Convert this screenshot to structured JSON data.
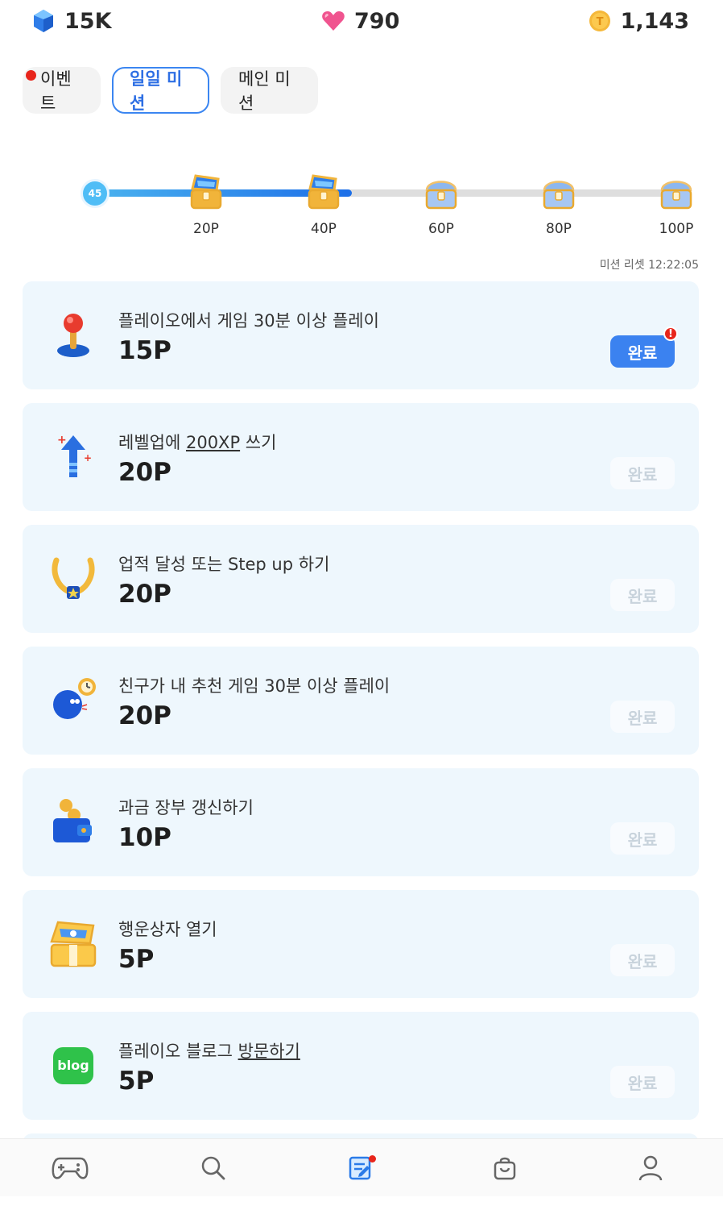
{
  "currency": {
    "gems": "15K",
    "hearts": "790",
    "coins": "1,143",
    "gem_icon": "blue-gem-icon",
    "heart_icon": "pink-heart-icon",
    "coin_icon": "gold-coin-icon"
  },
  "tabs": [
    {
      "label": "이벤트",
      "active": false,
      "has_dot": true
    },
    {
      "label": "일일 미션",
      "active": true,
      "has_dot": false
    },
    {
      "label": "메인 미션",
      "active": false,
      "has_dot": false
    }
  ],
  "progress": {
    "current": "45",
    "current_points": 45,
    "max_points": 100,
    "milestones": [
      {
        "label": "20P",
        "points": 20,
        "opened": true
      },
      {
        "label": "40P",
        "points": 40,
        "opened": true
      },
      {
        "label": "60P",
        "points": 60,
        "opened": false
      },
      {
        "label": "80P",
        "points": 80,
        "opened": false
      },
      {
        "label": "100P",
        "points": 100,
        "opened": false
      }
    ]
  },
  "reset_text": "미션 리셋 12:22:05",
  "missions": [
    {
      "title": "플레이오에서 게임 30분 이상 플레이",
      "points": "15P",
      "button": "완료",
      "enabled": true,
      "alert": "!",
      "icon": "joystick-icon"
    },
    {
      "title_pre": "레벨업에 ",
      "title_link": "200XP",
      "title_post": " 쓰기",
      "points": "20P",
      "button": "완료",
      "enabled": false,
      "icon": "level-up-arrow-icon"
    },
    {
      "title": "업적 달성 또는 Step up 하기",
      "points": "20P",
      "button": "완료",
      "enabled": false,
      "icon": "laurel-medal-icon"
    },
    {
      "title": "친구가 내 추천 게임 30분 이상 플레이",
      "points": "20P",
      "button": "완료",
      "enabled": false,
      "icon": "friend-clock-icon"
    },
    {
      "title": "과금 장부 갱신하기",
      "points": "10P",
      "button": "완료",
      "enabled": false,
      "icon": "wallet-coin-icon"
    },
    {
      "title": "행운상자 열기",
      "points": "5P",
      "button": "완료",
      "enabled": false,
      "icon": "lucky-box-icon"
    },
    {
      "title_pre": "플레이오 블로그 ",
      "title_link": "방문하기",
      "title_post": "",
      "points": "5P",
      "button": "완료",
      "enabled": false,
      "icon": "blog-icon",
      "icon_text": "blog"
    }
  ],
  "nav": [
    {
      "name": "games",
      "icon": "gamepad-icon",
      "active": false
    },
    {
      "name": "search",
      "icon": "search-icon",
      "active": false
    },
    {
      "name": "missions",
      "icon": "mission-scroll-icon",
      "active": true,
      "dot": true
    },
    {
      "name": "shop",
      "icon": "shopping-bag-icon",
      "active": false
    },
    {
      "name": "profile",
      "icon": "profile-icon",
      "active": false
    }
  ]
}
